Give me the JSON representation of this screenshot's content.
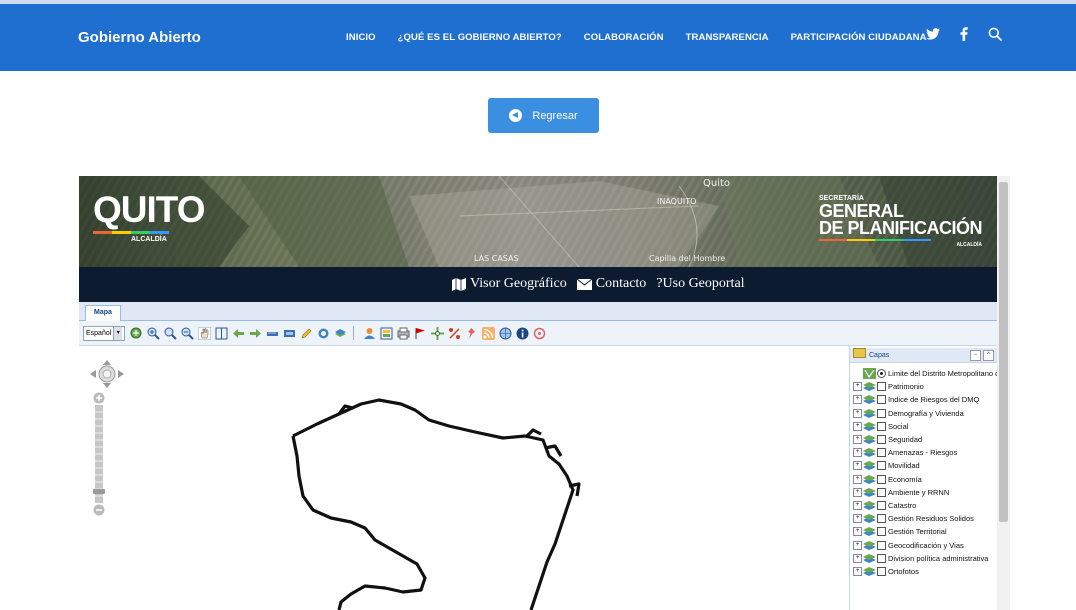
{
  "header": {
    "brand": "Gobierno Abierto",
    "nav": [
      "INICIO",
      "¿QUÉ ES EL GOBIERNO ABIERTO?",
      "COLABORACIÓN",
      "TRANSPARENCIA",
      "PARTICIPACIÓN CIUDADANA"
    ],
    "accent": "#1f6fd1"
  },
  "back_button": {
    "label": "Regresar",
    "color": "#3a8fe0"
  },
  "geoportal": {
    "banner": {
      "logo": "QUITO",
      "logo_sub": "ALCALDÍA",
      "labels": [
        "Quito",
        "INAQUITO",
        "LAS CASAS",
        "Capilla del Hombre"
      ],
      "dept_small": "SECRETARÍA",
      "dept_line1": "GENERAL",
      "dept_line2": "DE PLANIFICACIÓN",
      "dept_tag": "ALCALDÍA"
    },
    "nav": {
      "visor": "Visor Geográfico",
      "contacto": "Contacto",
      "uso": "?Uso Geoportal"
    },
    "tab": "Mapa",
    "language": "Español",
    "layers_title": "Capas",
    "base_layer": "Limite del Distrito Metropolitano de Quito",
    "layers": [
      "Patrimonio",
      "Indice de Riesgos del DMQ",
      "Demografía y Vivienda",
      "Social",
      "Seguridad",
      "Amenazas - Riesgos",
      "Movilidad",
      "Economía",
      "Ambiente y RRNN",
      "Catastro",
      "Gestión Residuos Solidos",
      "Gestión Territorial",
      "Geocodificación y Vias",
      "Division política administrativa",
      "Ortofotos"
    ]
  }
}
